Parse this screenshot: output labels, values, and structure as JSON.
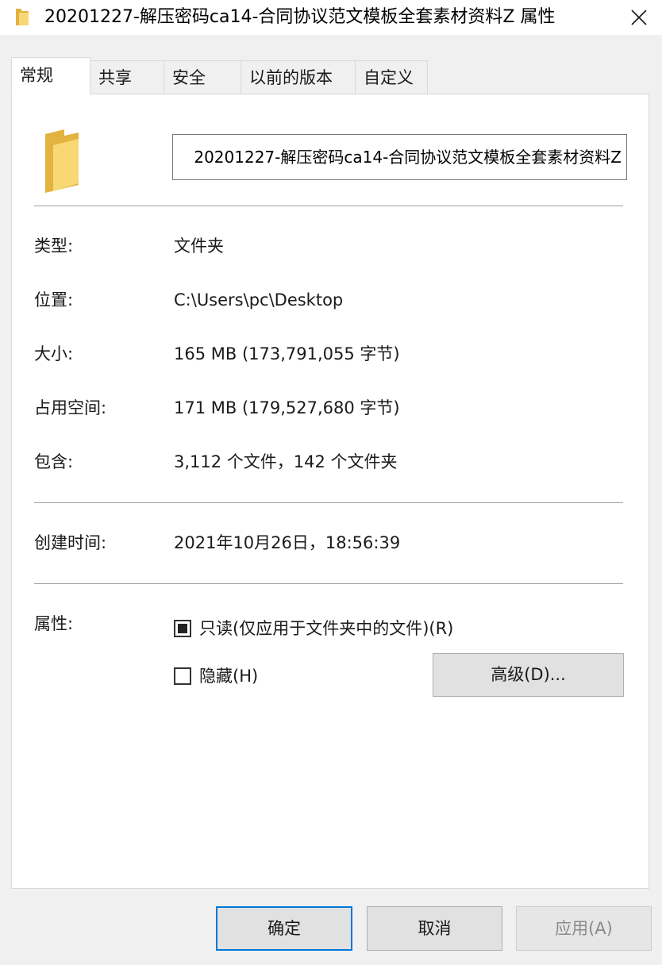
{
  "window": {
    "title": "20201227-解压密码ca14-合同协议范文模板全套素材资料Z 属性"
  },
  "tabs": [
    {
      "label": "常规",
      "active": true
    },
    {
      "label": "共享",
      "active": false
    },
    {
      "label": "安全",
      "active": false
    },
    {
      "label": "以前的版本",
      "active": false
    },
    {
      "label": "自定义",
      "active": false
    }
  ],
  "general": {
    "name_value": "20201227-解压密码ca14-合同协议范文模板全套素材资料Z",
    "type_label": "类型:",
    "type_value": "文件夹",
    "location_label": "位置:",
    "location_value": "C:\\Users\\pc\\Desktop",
    "size_label": "大小:",
    "size_value": "165 MB (173,791,055 字节)",
    "disk_label": "占用空间:",
    "disk_value": "171 MB (179,527,680 字节)",
    "contains_label": "包含:",
    "contains_value": "3,112 个文件，142 个文件夹",
    "created_label": "创建时间:",
    "created_value": "2021年10月26日，18:56:39",
    "attributes_label": "属性:",
    "readonly_label": "只读(仅应用于文件夹中的文件)(R)",
    "readonly_state": "indeterminate",
    "hidden_label": "隐藏(H)",
    "hidden_state": "unchecked",
    "advanced_label": "高级(D)..."
  },
  "footer": {
    "ok_label": "确定",
    "cancel_label": "取消",
    "apply_label": "应用(A)"
  },
  "colors": {
    "accent": "#0078d7",
    "folder_yellow": "#f8d775",
    "folder_dark": "#e2b33e"
  }
}
